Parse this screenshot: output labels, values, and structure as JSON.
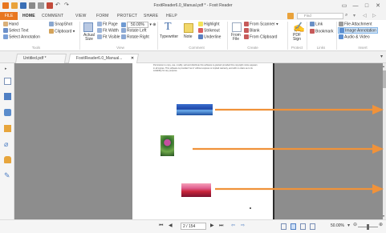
{
  "window": {
    "title": "FoxitReader6.0_Manual.pdf * - Foxit Reader",
    "controls": [
      "▭",
      "—",
      "□",
      "✕"
    ]
  },
  "menu": {
    "file": "FILE",
    "items": [
      "HOME",
      "COMMENT",
      "VIEW",
      "FORM",
      "PROTECT",
      "SHARE",
      "HELP"
    ],
    "active": "HOME",
    "find_placeholder": "Find"
  },
  "ribbon": {
    "tools_group": {
      "hand": "Hand",
      "select_text": "Select Text",
      "select_annotation": "Select Annotation",
      "snapshot": "SnapShot",
      "clipboard": "Clipboard",
      "label": "Tools"
    },
    "view_group": {
      "actual_size": "Actual Size",
      "fit_page": "Fit Page",
      "fit_width": "Fit Width",
      "fit_visible": "Fit Visible",
      "zoom_value": "50.00%",
      "rotate_left": "Rotate Left",
      "rotate_right": "Rotate Right",
      "label": "View"
    },
    "comment_group": {
      "typewriter": "Typewriter",
      "note": "Note",
      "highlight": "Highlight",
      "strikeout": "Strikeout",
      "underline": "Underline",
      "label": "Comment"
    },
    "create_group": {
      "from_file": "From File",
      "from_scanner": "From Scanner",
      "blank": "Blank",
      "from_clipboard": "From Clipboard",
      "label": "Create"
    },
    "protect_group": {
      "pdf_sign": "PDF Sign",
      "label": "Protect"
    },
    "links_group": {
      "link": "Link",
      "bookmark": "Bookmark",
      "label": "Links"
    },
    "insert_group": {
      "file_attachment": "File Attachment",
      "image_annotation": "Image Annotation",
      "audio_video": "Audio & Video",
      "label": "Insert"
    }
  },
  "tabs": [
    {
      "label": "Untitled.pdf *"
    },
    {
      "label": "FoxitReader6.0_Manual..."
    }
  ],
  "document": {
    "text": "Permission to copy, use, modify, sell and distribute this software is granted provided this copyright notice appears in all copies. This software is provided \"as is\" without express or implied warranty, and with no claim as to its suitability for any purpose."
  },
  "status": {
    "page_box": "2 / 154",
    "zoom": "50.00%"
  },
  "colors": {
    "accent": "#e8761f",
    "arrow": "#f0923a",
    "doc_background": "#8d8d8d"
  }
}
